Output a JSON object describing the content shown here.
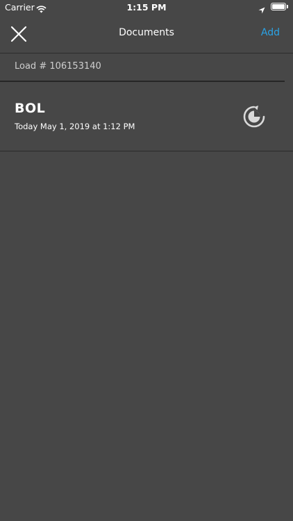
{
  "status_bar": {
    "carrier": "Carrier",
    "time": "1:15 PM"
  },
  "nav": {
    "title": "Documents",
    "add_label": "Add"
  },
  "load": {
    "label": "Load # 106153140"
  },
  "documents": [
    {
      "title": "BOL",
      "date": "Today May 1, 2019 at 1:12 PM",
      "status_icon": "sync-icon"
    }
  ],
  "colors": {
    "background": "#474747",
    "accent": "#2aa3e6",
    "divider": "#2d2d2d"
  }
}
